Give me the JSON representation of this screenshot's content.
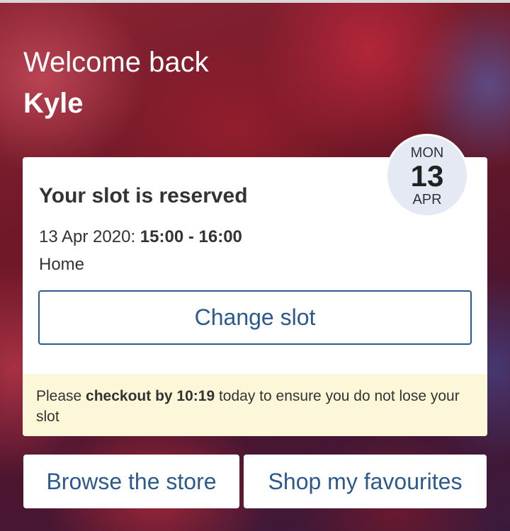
{
  "header": {
    "welcome_text": "Welcome back",
    "user_name": "Kyle"
  },
  "slot_card": {
    "title": "Your slot is reserved",
    "date": "13 Apr 2020:",
    "time_range": "15:00 - 16:00",
    "location": "Home",
    "change_slot_label": "Change slot",
    "badge": {
      "day": "MON",
      "date": "13",
      "month": "APR"
    },
    "notice": {
      "prefix": "Please ",
      "emphasis": "checkout by 10:19",
      "suffix": " today to ensure you do not lose your slot"
    }
  },
  "actions": {
    "browse_label": "Browse the store",
    "favourites_label": "Shop my favourites"
  },
  "colors": {
    "accent": "#2c5a8c",
    "notice_background": "#fbf7d8",
    "badge_background": "#e4e9f3"
  }
}
